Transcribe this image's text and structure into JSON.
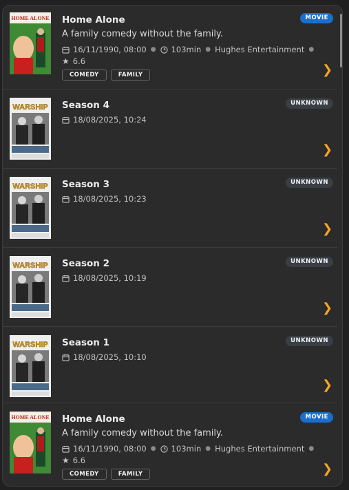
{
  "items": [
    {
      "type": "movie",
      "title": "Home Alone",
      "description": "A family comedy without the family.",
      "date": "16/11/1990, 08:00",
      "runtime": "103min",
      "studio": "Hughes Entertainment",
      "rating": "6.6",
      "genres": [
        "COMEDY",
        "FAMILY"
      ],
      "badge": "MOVIE",
      "poster_title": "HOME ALONE",
      "chevron": "❯"
    },
    {
      "type": "unknown",
      "title": "Season 4",
      "date": "18/08/2025, 10:24",
      "badge": "UNKNOWN",
      "poster_title": "WARSHIP",
      "chevron": "❯"
    },
    {
      "type": "unknown",
      "title": "Season 3",
      "date": "18/08/2025, 10:23",
      "badge": "UNKNOWN",
      "poster_title": "WARSHIP",
      "chevron": "❯"
    },
    {
      "type": "unknown",
      "title": "Season 2",
      "date": "18/08/2025, 10:19",
      "badge": "UNKNOWN",
      "poster_title": "WARSHIP",
      "chevron": "❯"
    },
    {
      "type": "unknown",
      "title": "Season 1",
      "date": "18/08/2025, 10:10",
      "badge": "UNKNOWN",
      "poster_title": "WARSHIP",
      "chevron": "❯"
    },
    {
      "type": "movie",
      "title": "Home Alone",
      "description": "A family comedy without the family.",
      "date": "16/11/1990, 08:00",
      "runtime": "103min",
      "studio": "Hughes Entertainment",
      "rating": "6.6",
      "genres": [
        "COMEDY",
        "FAMILY"
      ],
      "badge": "MOVIE",
      "poster_title": "HOME ALONE",
      "chevron": "❯"
    }
  ],
  "colors": {
    "movie_badge": "#1a6fcc",
    "unknown_badge": "#3a3f46",
    "chevron": "#f5a623"
  },
  "icons": {
    "date": "calendar-icon",
    "runtime": "clock-icon",
    "rating": "star-icon"
  }
}
